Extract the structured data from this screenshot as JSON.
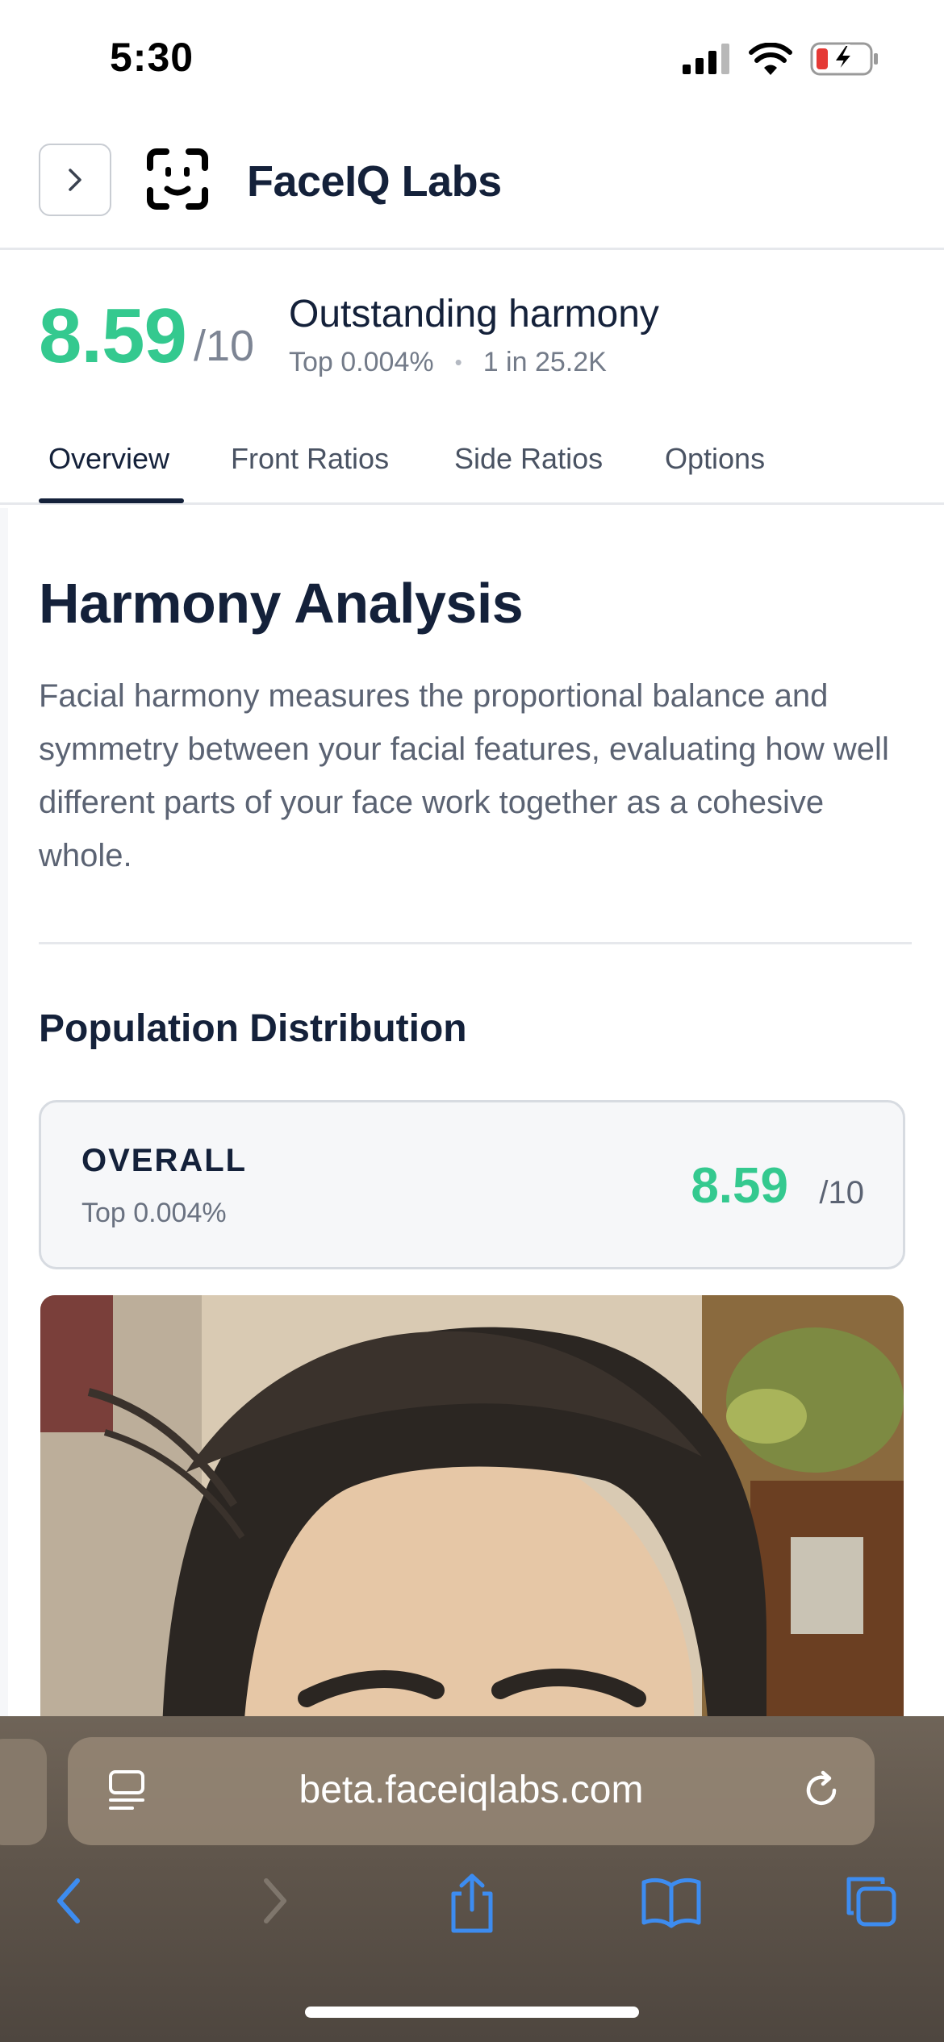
{
  "status_bar": {
    "time": "5:30",
    "icons": [
      "signal-icon",
      "wifi-icon",
      "battery-charging-icon"
    ],
    "battery_color": "#e53935"
  },
  "header": {
    "title": "FaceIQ Labs",
    "expand_icon": "chevron-right-icon",
    "logo_icon": "face-scan-icon"
  },
  "score_summary": {
    "score": "8.59",
    "denominator": "/10",
    "label": "Outstanding harmony",
    "rank_percent": "Top 0.004%",
    "rank_ratio": "1 in 25.2K"
  },
  "tabs": [
    {
      "label": "Overview",
      "active": true
    },
    {
      "label": "Front Ratios",
      "active": false
    },
    {
      "label": "Side Ratios",
      "active": false
    },
    {
      "label": "Options",
      "active": false
    }
  ],
  "main": {
    "title": "Harmony Analysis",
    "description": "Facial harmony measures the proportional balance and symmetry between your facial features, evaluating how well different parts of your face work together as a cohesive whole.",
    "population": {
      "title": "Population Distribution",
      "card": {
        "label": "OVERALL",
        "rank": "Top 0.004%",
        "score": "8.59",
        "denominator": "/10"
      }
    }
  },
  "browser": {
    "url": "beta.faceiqlabs.com",
    "toolbar_icons": [
      "back-icon",
      "forward-icon",
      "share-icon",
      "bookmarks-icon",
      "tabs-icon"
    ]
  },
  "colors": {
    "accent_green": "#34c98f",
    "text_dark": "#14213a",
    "toolbar_blue": "#3d8cf0"
  }
}
